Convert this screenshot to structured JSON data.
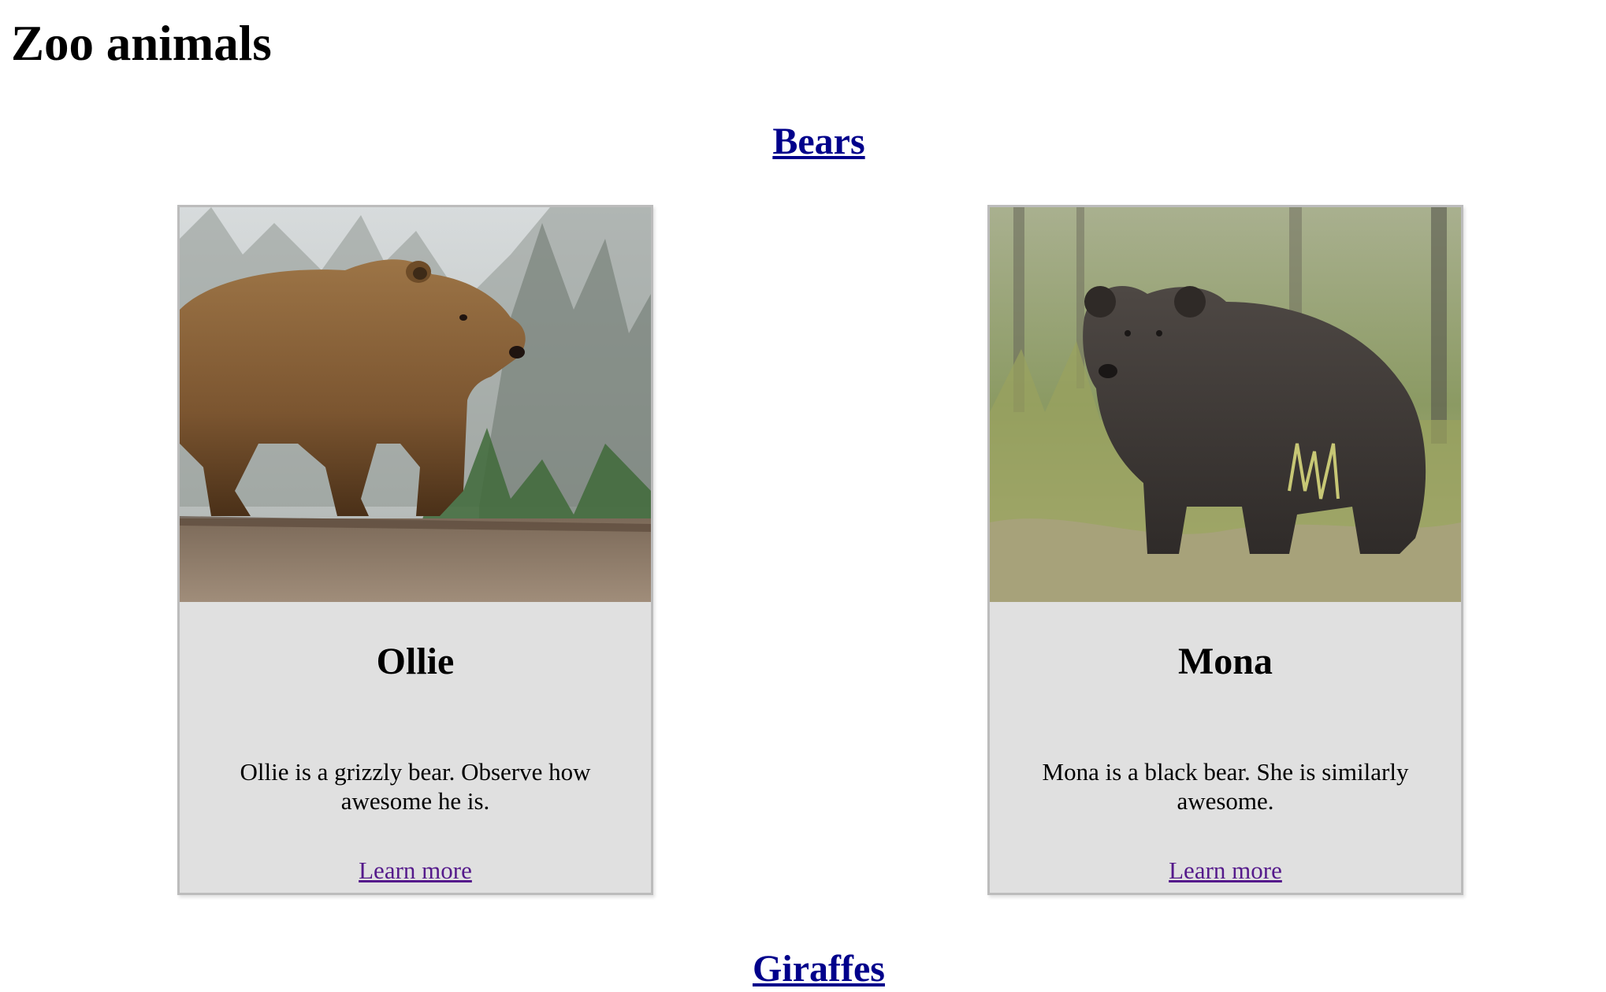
{
  "page": {
    "title": "Zoo animals"
  },
  "sections": [
    {
      "heading": "Bears",
      "animals": [
        {
          "name": "Ollie",
          "image": "grizzly-bear-photo",
          "description": "Ollie is a grizzly bear. Observe how awesome he is.",
          "link_label": "Learn more"
        },
        {
          "name": "Mona",
          "image": "black-bear-photo",
          "description": "Mona is a black bear. She is similarly awesome.",
          "link_label": "Learn more"
        }
      ]
    },
    {
      "heading": "Giraffes"
    }
  ],
  "colors": {
    "heading_link": "#00008b",
    "visited_link": "#551a8b",
    "card_background": "#e0e0e0",
    "card_border": "#bcbcbc"
  }
}
